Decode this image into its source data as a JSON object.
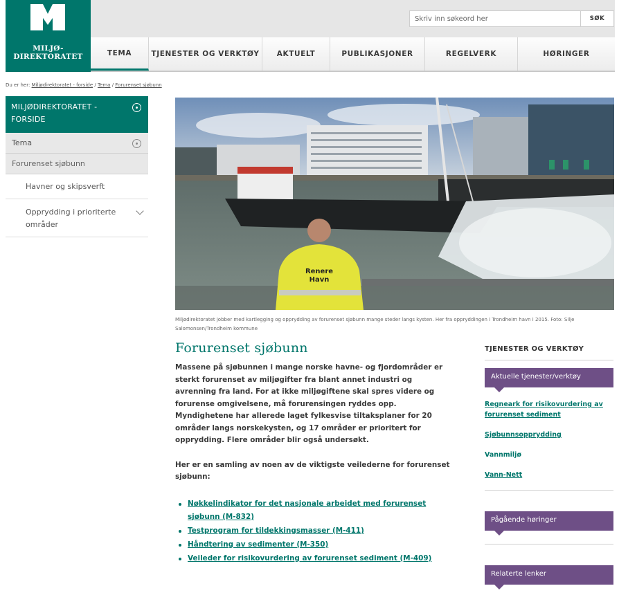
{
  "header": {
    "logo_line1": "MILJØ-",
    "logo_line2": "DIREKTORATET",
    "search_placeholder": "Skriv inn søkeord her",
    "search_button": "SØK",
    "nav": [
      {
        "label": "TEMA"
      },
      {
        "label": "TJENESTER OG VERKTØY"
      },
      {
        "label": "AKTUELT"
      },
      {
        "label": "PUBLIKASJONER"
      },
      {
        "label": "REGELVERK"
      },
      {
        "label": "HØRINGER"
      }
    ]
  },
  "breadcrumb": {
    "prefix": "Du er her:",
    "items": [
      "Miljødirektoratet - forside",
      "Tema",
      "Forurenset sjøbunn"
    ],
    "separator": " / "
  },
  "sidenav": {
    "home": "MILJØDIREKTORATET - FORSIDE",
    "tema": "Tema",
    "current": "Forurenset sjøbunn",
    "sub": [
      "Havner og skipsverft",
      "Opprydding i prioriterte områder"
    ]
  },
  "hero": {
    "vest_text_1": "Renere",
    "vest_text_2": "Havn",
    "caption": "Miljødirektoratet jobber med kartlegging og opprydding av forurenset sjøbunn mange steder langs kysten. Her fra oppryddingen i Trondheim havn i 2015. Foto: Silje Salomonsen/Trondheim kommune"
  },
  "main": {
    "title": "Forurenset sjøbunn",
    "intro": "Massene på sjøbunnen i mange norske havne- og fjordområder er sterkt forurenset av miljøgifter fra blant annet industri og avrenning fra land. For at ikke miljøgiftene skal spres videre og forurense omgivelsene, må forurensingen ryddes opp. Myndighetene har allerede laget fylkesvise tiltaksplaner for 20 områder langs norskekysten, og 17 områder er prioritert for opprydding. Flere områder blir også undersøkt.",
    "lead2": "Her er en samling av noen av de viktigste veilederne for forurenset sjøbunn:",
    "links": [
      "Nøkkelindikator for det nasjonale arbeidet med forurenset sjøbunn (M-832)",
      "Testprogram for tildekkingsmasser (M-411)",
      "Håndtering av sedimenter (M-350)",
      "Veileder for risikovurdering av forurenset sediment (M-409)"
    ]
  },
  "rightcol": {
    "heading": "TJENESTER OG VERKTØY",
    "tag1": "Aktuelle tjenester/verktøy",
    "links": [
      "Regneark for risikovurdering av forurenset sediment",
      "Sjøbunnsopprydding",
      "Vannmiljø",
      "Vann-Nett"
    ],
    "tag2": "Pågående høringer",
    "tag3": "Relaterte lenker"
  },
  "colors": {
    "brand": "#00766b",
    "purple": "#6e4f86"
  }
}
